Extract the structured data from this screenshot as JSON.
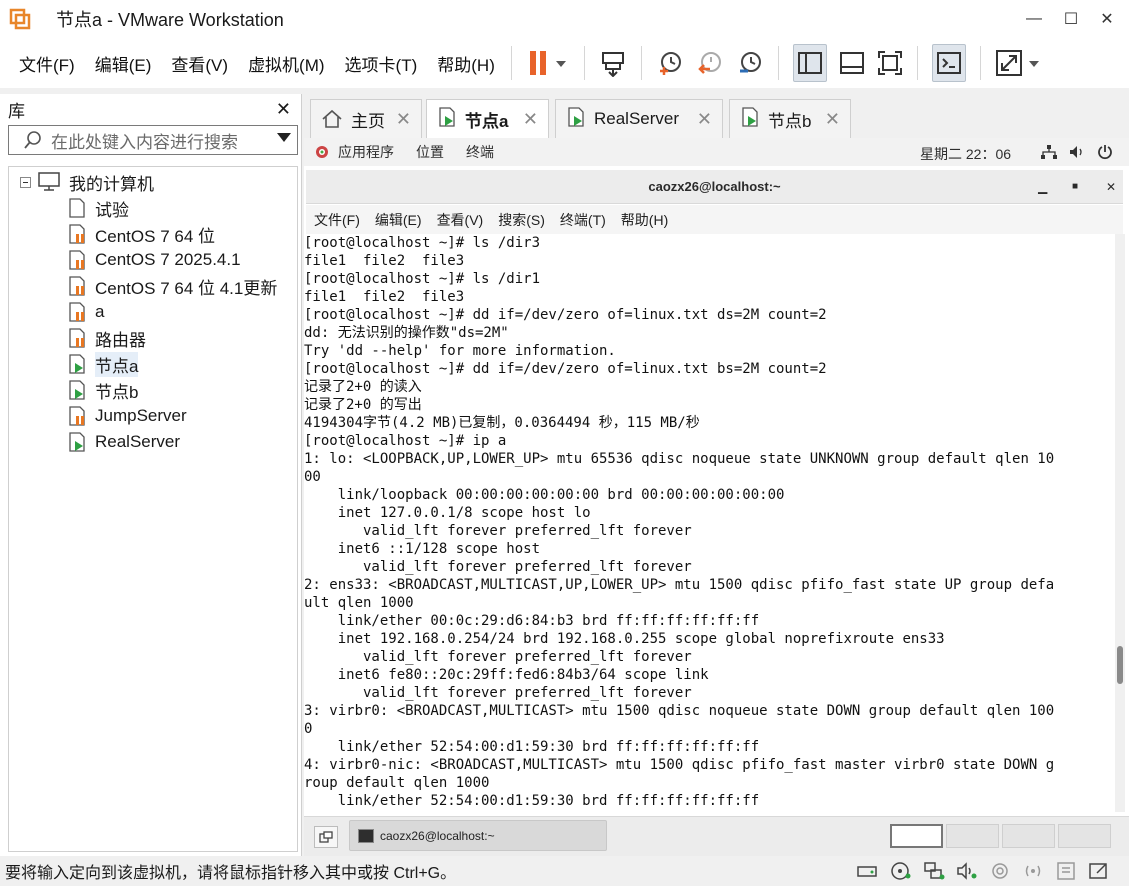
{
  "window": {
    "title": "节点a - VMware Workstation",
    "minimize": "—",
    "maximize": "☐",
    "close": "✕"
  },
  "menu": [
    "文件(F)",
    "编辑(E)",
    "查看(V)",
    "虚拟机(M)",
    "选项卡(T)",
    "帮助(H)"
  ],
  "colors": {
    "accent_orange": "#e8632a",
    "vm_green": "#2ea043",
    "vm_orange": "#e87722",
    "toolbar_blue": "#2d6db5"
  },
  "library": {
    "title": "库",
    "close": "✕",
    "search_placeholder": "在此处键入内容进行搜索",
    "root": "我的计算机",
    "items": [
      {
        "label": "试验",
        "icon": "vm-off-icon"
      },
      {
        "label": "CentOS 7 64 位",
        "icon": "vm-paused-icon"
      },
      {
        "label": "CentOS 7 2025.4.1",
        "icon": "vm-paused-icon"
      },
      {
        "label": "CentOS 7 64 位 4.1更新",
        "icon": "vm-paused-icon"
      },
      {
        "label": "a",
        "icon": "vm-paused-icon"
      },
      {
        "label": "路由器",
        "icon": "vm-paused-icon"
      },
      {
        "label": "节点a",
        "icon": "vm-running-icon"
      },
      {
        "label": "节点b",
        "icon": "vm-running-icon"
      },
      {
        "label": "JumpServer",
        "icon": "vm-paused-icon"
      },
      {
        "label": "RealServer",
        "icon": "vm-running-icon"
      }
    ]
  },
  "tabs": [
    {
      "label": "主页",
      "icon": "home-icon"
    },
    {
      "label": "节点a",
      "icon": "vm-running-icon",
      "active": true
    },
    {
      "label": "RealServer",
      "icon": "vm-running-icon"
    },
    {
      "label": "节点b",
      "icon": "vm-running-icon"
    }
  ],
  "tab_close": "✕",
  "guest": {
    "topbar": {
      "apps": "应用程序",
      "places": "位置",
      "terminal": "终端",
      "clock": "星期二 22：06"
    },
    "terminal": {
      "title": "caozx26@localhost:~",
      "menu": [
        "文件(F)",
        "编辑(E)",
        "查看(V)",
        "搜索(S)",
        "终端(T)",
        "帮助(H)"
      ],
      "lines": [
        "[root@localhost ~]# ls /dir3",
        "file1  file2  file3",
        "[root@localhost ~]# ls /dir1",
        "file1  file2  file3",
        "[root@localhost ~]# dd if=/dev/zero of=linux.txt ds=2M count=2",
        "dd: 无法识别的操作数\"ds=2M\"",
        "Try 'dd --help' for more information.",
        "[root@localhost ~]# dd if=/dev/zero of=linux.txt bs=2M count=2",
        "记录了2+0 的读入",
        "记录了2+0 的写出",
        "4194304字节(4.2 MB)已复制，0.0364494 秒，115 MB/秒",
        "[root@localhost ~]# ip a",
        "1: lo: <LOOPBACK,UP,LOWER_UP> mtu 65536 qdisc noqueue state UNKNOWN group default qlen 10",
        "00",
        "    link/loopback 00:00:00:00:00:00 brd 00:00:00:00:00:00",
        "    inet 127.0.0.1/8 scope host lo",
        "       valid_lft forever preferred_lft forever",
        "    inet6 ::1/128 scope host",
        "       valid_lft forever preferred_lft forever",
        "2: ens33: <BROADCAST,MULTICAST,UP,LOWER_UP> mtu 1500 qdisc pfifo_fast state UP group defa",
        "ult qlen 1000",
        "    link/ether 00:0c:29:d6:84:b3 brd ff:ff:ff:ff:ff:ff",
        "    inet 192.168.0.254/24 brd 192.168.0.255 scope global noprefixroute ens33",
        "       valid_lft forever preferred_lft forever",
        "    inet6 fe80::20c:29ff:fed6:84b3/64 scope link",
        "       valid_lft forever preferred_lft forever",
        "3: virbr0: <BROADCAST,MULTICAST> mtu 1500 qdisc noqueue state DOWN group default qlen 100",
        "0",
        "    link/ether 52:54:00:d1:59:30 brd ff:ff:ff:ff:ff:ff",
        "4: virbr0-nic: <BROADCAST,MULTICAST> mtu 1500 qdisc pfifo_fast master virbr0 state DOWN g",
        "roup default qlen 1000",
        "    link/ether 52:54:00:d1:59:30 brd ff:ff:ff:ff:ff:ff"
      ]
    },
    "taskbar": {
      "task_label": "caozx26@localhost:~"
    }
  },
  "status": {
    "message": "要将输入定向到该虚拟机，请将鼠标指针移入其中或按 Ctrl+G。"
  }
}
